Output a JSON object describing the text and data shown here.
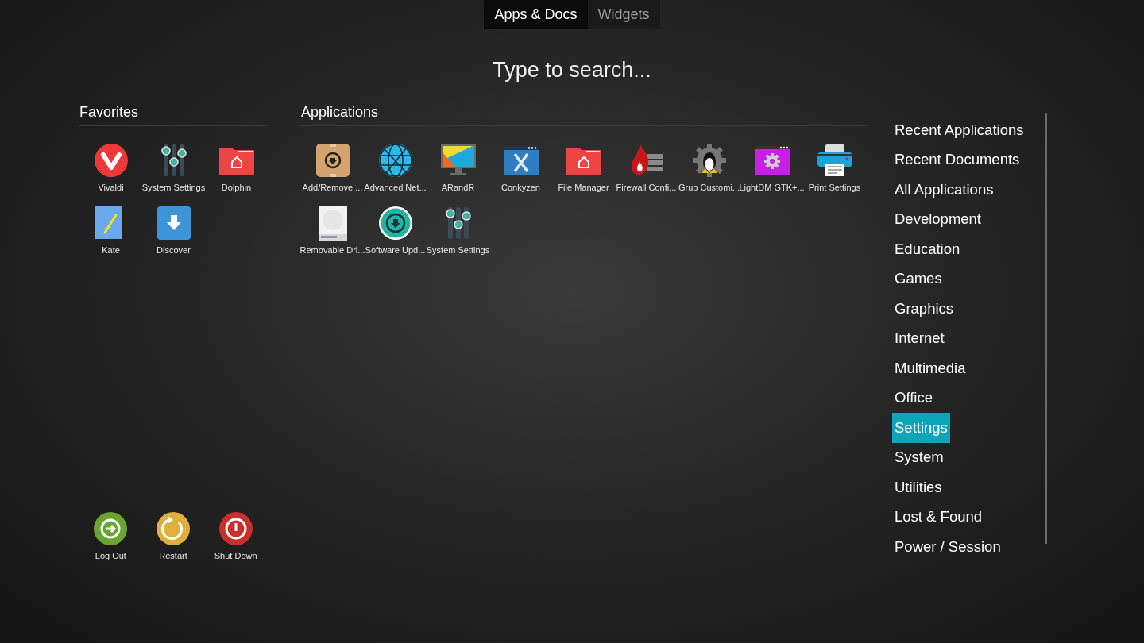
{
  "tabs": [
    {
      "label": "Apps & Docs",
      "selected": true
    },
    {
      "label": "Widgets",
      "selected": false
    }
  ],
  "search": {
    "placeholder": "Type to search..."
  },
  "favorites": {
    "title": "Favorites",
    "items": [
      {
        "label": "Vivaldi",
        "kind": "vivaldi"
      },
      {
        "label": "System Settings",
        "kind": "sliders"
      },
      {
        "label": "Dolphin",
        "kind": "folder"
      },
      {
        "label": "Kate",
        "kind": "kate"
      },
      {
        "label": "Discover",
        "kind": "discover"
      }
    ]
  },
  "applications": {
    "title": "Applications",
    "items": [
      {
        "label": "Add/Remove ...",
        "kind": "package"
      },
      {
        "label": "Advanced Net...",
        "kind": "globe"
      },
      {
        "label": "ARandR",
        "kind": "monitor"
      },
      {
        "label": "Conkyzen",
        "kind": "window-x"
      },
      {
        "label": "File Manager",
        "kind": "folder"
      },
      {
        "label": "Firewall Confi...",
        "kind": "firewall"
      },
      {
        "label": "Grub Customi...",
        "kind": "gear-penguin"
      },
      {
        "label": "LightDM GTK+...",
        "kind": "window-gear"
      },
      {
        "label": "Print Settings",
        "kind": "printer"
      },
      {
        "label": "Removable Dri...",
        "kind": "drive"
      },
      {
        "label": "Software Upd...",
        "kind": "update"
      },
      {
        "label": "System Settings",
        "kind": "sliders"
      }
    ]
  },
  "session": [
    {
      "label": "Log Out",
      "kind": "logout",
      "color": "#6aa531"
    },
    {
      "label": "Restart",
      "kind": "restart",
      "color": "#e0b03e"
    },
    {
      "label": "Shut Down",
      "kind": "shutdown",
      "color": "#c9302c"
    }
  ],
  "categories": [
    {
      "label": "Recent Applications",
      "selected": false
    },
    {
      "label": "Recent Documents",
      "selected": false
    },
    {
      "label": "All Applications",
      "selected": false
    },
    {
      "label": "Development",
      "selected": false
    },
    {
      "label": "Education",
      "selected": false
    },
    {
      "label": "Games",
      "selected": false
    },
    {
      "label": "Graphics",
      "selected": false
    },
    {
      "label": "Internet",
      "selected": false
    },
    {
      "label": "Multimedia",
      "selected": false
    },
    {
      "label": "Office",
      "selected": false
    },
    {
      "label": "Settings",
      "selected": true
    },
    {
      "label": "System",
      "selected": false
    },
    {
      "label": "Utilities",
      "selected": false
    },
    {
      "label": "Lost & Found",
      "selected": false
    },
    {
      "label": "Power / Session",
      "selected": false
    }
  ]
}
